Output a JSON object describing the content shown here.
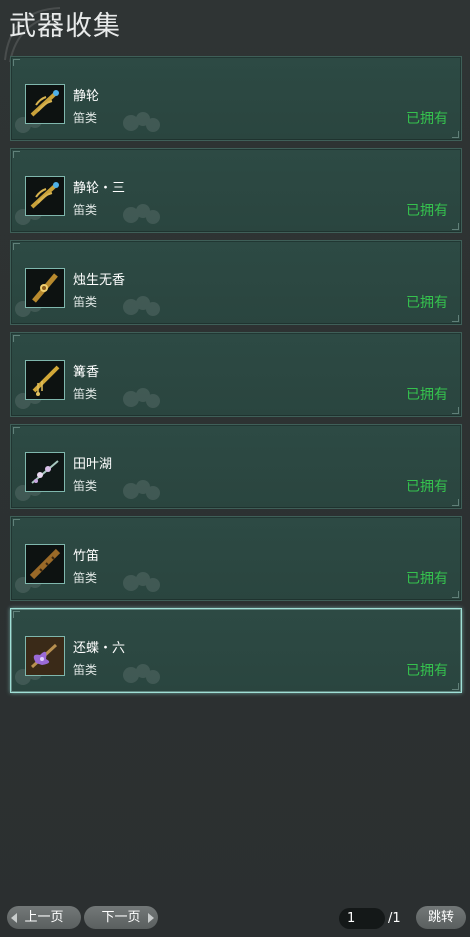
{
  "window": {
    "title": "武器收集"
  },
  "items": [
    {
      "name": "静轮",
      "type": "笛类",
      "status": "已拥有",
      "icon": "golden-flute-with-blue-gem-icon",
      "selected": false
    },
    {
      "name": "静轮・三",
      "type": "笛类",
      "status": "已拥有",
      "icon": "golden-flute-with-blue-gem-icon",
      "selected": false
    },
    {
      "name": "烛生无香",
      "type": "笛类",
      "status": "已拥有",
      "icon": "ornate-gold-flute-icon",
      "selected": false
    },
    {
      "name": "篝香",
      "type": "笛类",
      "status": "已拥有",
      "icon": "gold-flute-with-tassel-icon",
      "selected": false
    },
    {
      "name": "田叶湖",
      "type": "笛类",
      "status": "已拥有",
      "icon": "flower-branch-flute-icon",
      "selected": false
    },
    {
      "name": "竹笛",
      "type": "笛类",
      "status": "已拥有",
      "icon": "bamboo-flute-icon",
      "selected": false
    },
    {
      "name": "还蝶・六",
      "type": "笛类",
      "status": "已拥有",
      "icon": "purple-butterfly-flute-icon",
      "selected": true
    }
  ],
  "pagination": {
    "prev_label": "上一页",
    "next_label": "下一页",
    "current_page": "1",
    "total_pages": "/1",
    "jump_label": "跳转"
  },
  "colors": {
    "owned_text": "#35c24e",
    "card_bg": "#2d4a44",
    "selected_border": "#9fe0d6"
  }
}
